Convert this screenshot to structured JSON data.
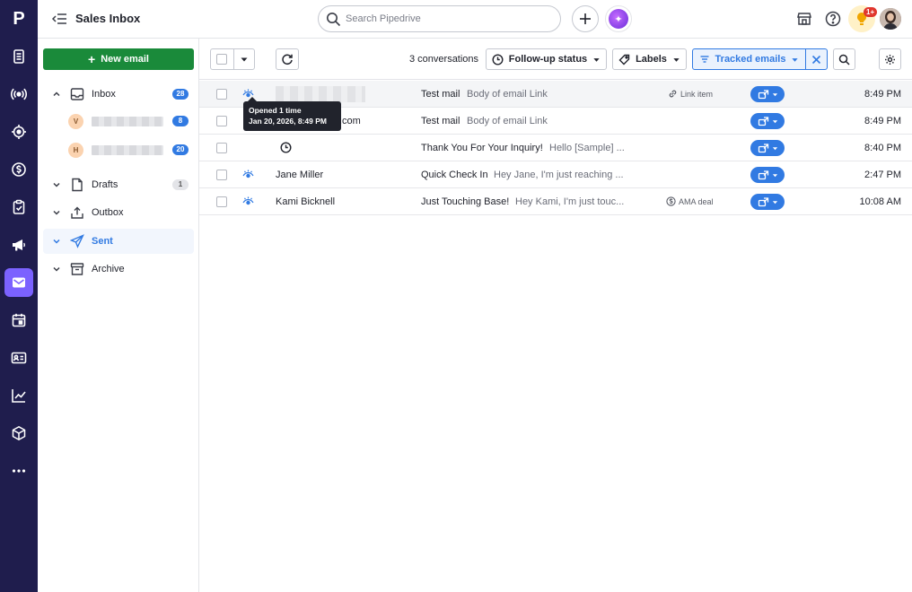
{
  "app": {
    "logo": "P",
    "title": "Sales Inbox"
  },
  "search": {
    "placeholder": "Search Pipedrive"
  },
  "notifications": {
    "badge": "1+"
  },
  "sidebar": {
    "new_email_label": "New email",
    "folders": [
      {
        "label": "Inbox",
        "count": "28"
      },
      {
        "label": "Drafts",
        "count": "1"
      },
      {
        "label": "Outbox"
      },
      {
        "label": "Sent"
      },
      {
        "label": "Archive"
      }
    ],
    "accounts": [
      {
        "initial": "V",
        "count": "8"
      },
      {
        "initial": "H",
        "count": "20"
      }
    ]
  },
  "toolbar": {
    "conversation_count": "3 conversations",
    "follow_up_label": "Follow-up status",
    "labels_label": "Labels",
    "tracked_label": "Tracked emails"
  },
  "tooltip": {
    "line1": "Opened 1 time",
    "line2": "Jan 20, 2026, 8:49 PM"
  },
  "rows": [
    {
      "sender": "",
      "subject": "Test mail",
      "preview": "Body of email Link",
      "tag": "Link item",
      "time": "8:49 PM"
    },
    {
      "sender": ".com",
      "subject": "Test mail",
      "preview": "Body of email Link",
      "tag": "",
      "time": "8:49 PM"
    },
    {
      "sender": "",
      "subject": "Thank You For Your Inquiry!",
      "preview": "Hello [Sample] ...",
      "tag": "",
      "time": "8:40 PM"
    },
    {
      "sender": "Jane Miller",
      "subject": "Quick Check In",
      "preview": "Hey Jane, I'm just reaching ...",
      "tag": "",
      "time": "2:47 PM"
    },
    {
      "sender": "Kami Bicknell",
      "subject": "Just Touching Base!",
      "preview": "Hey Kami, I'm just touc...",
      "tag": "AMA deal",
      "time": "10:08 AM"
    }
  ],
  "colors": {
    "rail": "#1f1d4d",
    "accent": "#317ae2",
    "primary_green": "#1a8a3a",
    "rail_active": "#7b62ff"
  }
}
